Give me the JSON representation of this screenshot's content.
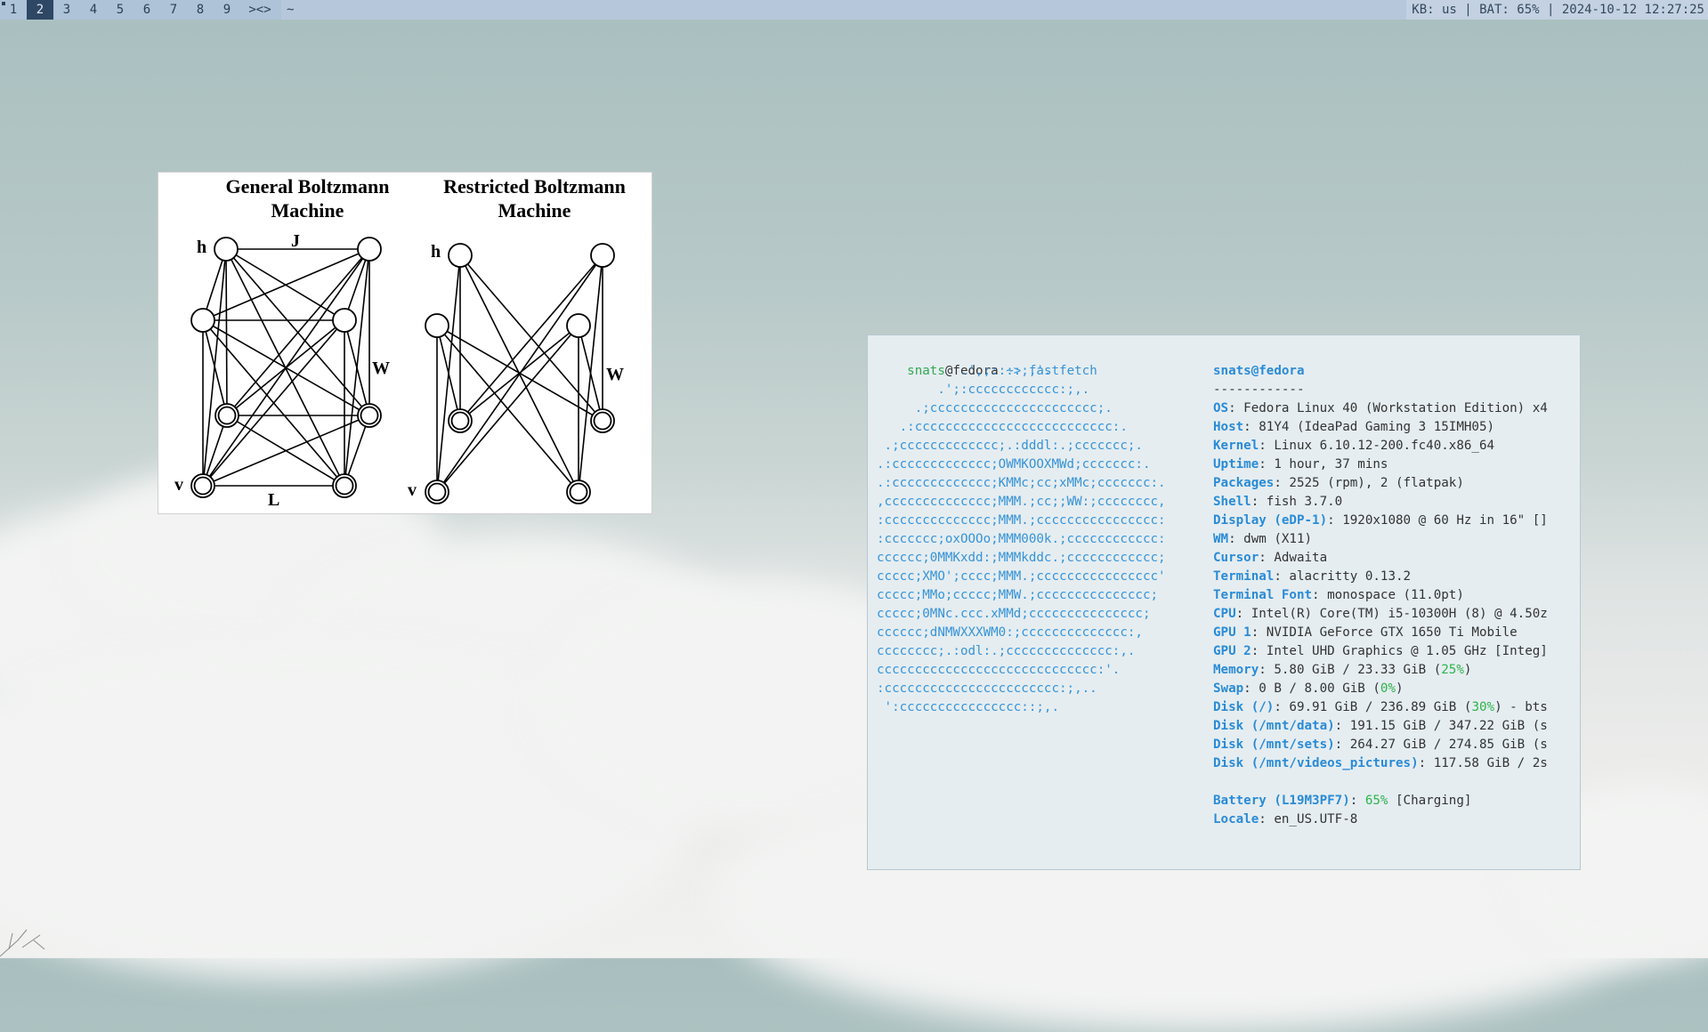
{
  "bar": {
    "workspaces": [
      "1",
      "2",
      "3",
      "4",
      "5",
      "6",
      "7",
      "8",
      "9"
    ],
    "active_workspace": "2",
    "layout": "><>",
    "window_title": "~",
    "status": "KB: us | BAT: 65% | 2024-10-12 12:27:25"
  },
  "diagram": {
    "left_title": "General Boltzmann Machine",
    "right_title": "Restricted Boltzmann Machine",
    "labels": {
      "h": "h",
      "v": "v",
      "J": "J",
      "W": "W",
      "L": "L"
    }
  },
  "terminal": {
    "prompt_user": "snats",
    "prompt_host": "@fedora",
    "prompt_path": " ~>",
    "command": "fastfetch",
    "logo_color": "#3793d6",
    "logo": [
      "           .',;::::;,'.",
      "        .';:cccccccccccc:;,.",
      "     .;cccccccccccccccccccccc;.",
      "   .:cccccccccccccccccccccccccc:.",
      " .;ccccccccccccc;.:dddl:.;ccccccc;.",
      ".:ccccccccccccc;OWMKOOXMWd;ccccccc:.",
      ".:ccccccccccccc;KMMc;cc;xMMc;ccccccc:.",
      ",cccccccccccccc;MMM.;cc;;WW:;cccccccc,",
      ":cccccccccccccc;MMM.;cccccccccccccccc:",
      ":ccccccc;oxOOOo;MMM000k.;cccccccccccc:",
      "cccccc;0MMKxdd:;MMMkddc.;cccccccccccc;",
      "ccccc;XMO';cccc;MMM.;cccccccccccccccc'",
      "ccccc;MMo;ccccc;MMW.;ccccccccccccccc;",
      "ccccc;0MNc.ccc.xMMd;ccccccccccccccc;",
      "cccccc;dNMWXXXWM0:;cccccccccccccc:,",
      "cccccccc;.:odl:.;cccccccccccccc:,.",
      "ccccccccccccccccccccccccccccc:'.",
      ":ccccccccccccccccccccccc:;,..",
      " ':cccccccccccccccc::;,."
    ],
    "user_title": "snats@fedora",
    "separator": "------------",
    "info": [
      {
        "key": "OS",
        "value": ": Fedora Linux 40 (Workstation Edition) x4"
      },
      {
        "key": "Host",
        "value": ": 81Y4 (IdeaPad Gaming 3 15IMH05)"
      },
      {
        "key": "Kernel",
        "value": ": Linux 6.10.12-200.fc40.x86_64"
      },
      {
        "key": "Uptime",
        "value": ": 1 hour, 37 mins"
      },
      {
        "key": "Packages",
        "value": ": 2525 (rpm), 2 (flatpak)"
      },
      {
        "key": "Shell",
        "value": ": fish 3.7.0"
      },
      {
        "key": "Display (eDP-1)",
        "value": ": 1920x1080 @ 60 Hz in 16\" []"
      },
      {
        "key": "WM",
        "value": ": dwm (X11)"
      },
      {
        "key": "Cursor",
        "value": ": Adwaita"
      },
      {
        "key": "Terminal",
        "value": ": alacritty 0.13.2"
      },
      {
        "key": "Terminal Font",
        "value": ": monospace (11.0pt)"
      },
      {
        "key": "CPU",
        "value": ": Intel(R) Core(TM) i5-10300H (8) @ 4.50z"
      },
      {
        "key": "GPU 1",
        "value": ": NVIDIA GeForce GTX 1650 Ti Mobile"
      },
      {
        "key": "GPU 2",
        "value": ": Intel UHD Graphics @ 1.05 GHz [Integ]"
      },
      {
        "key": "Memory",
        "value": ": 5.80 GiB / 23.33 GiB (",
        "pct": "25%",
        "tail": ")"
      },
      {
        "key": "Swap",
        "value": ": 0 B / 8.00 GiB (",
        "pct": "0%",
        "tail": ")"
      },
      {
        "key": "Disk (/)",
        "value": ": 69.91 GiB / 236.89 GiB (",
        "pct": "30%",
        "tail": ") - bts"
      },
      {
        "key": "Disk (/mnt/data)",
        "value": ": 191.15 GiB / 347.22 GiB (s"
      },
      {
        "key": "Disk (/mnt/sets)",
        "value": ": 264.27 GiB / 274.85 GiB (s"
      },
      {
        "key": "Disk (/mnt/videos_pictures)",
        "value": ": 117.58 GiB / 2s"
      },
      {
        "key": "",
        "value": ""
      },
      {
        "key": "Battery (L19M3PF7)",
        "value": ": ",
        "pct": "65%",
        "tail": " [Charging]"
      },
      {
        "key": "Locale",
        "value": ": en_US.UTF-8"
      }
    ]
  }
}
